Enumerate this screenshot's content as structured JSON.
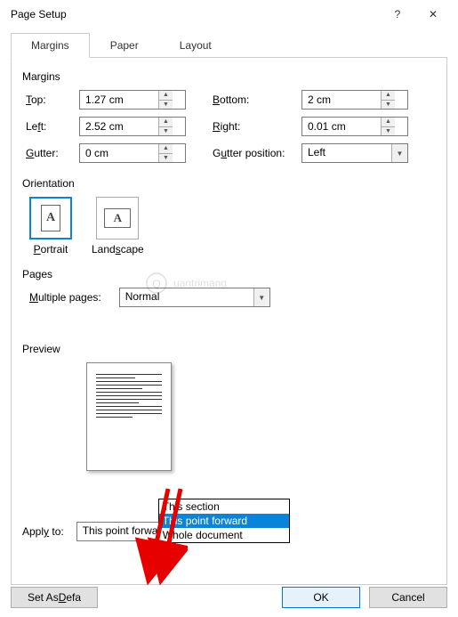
{
  "titlebar": {
    "title": "Page Setup",
    "help": "?",
    "close": "✕"
  },
  "tabs": {
    "margins": "Margins",
    "paper": "Paper",
    "layout": "Layout"
  },
  "margins": {
    "section": "Margins",
    "top_label": "op:",
    "top_value": "1.27 cm",
    "bottom_label": "ottom:",
    "bottom_value": "2 cm",
    "left_label": "Le",
    "left_label2": "t:",
    "left_value": "2.52 cm",
    "right_label": "ight:",
    "right_value": "0.01 cm",
    "gutter_label": "utter:",
    "gutter_value": "0 cm",
    "gutterpos_label": "G",
    "gutterpos_label2": "tter position:",
    "gutterpos_value": "Left"
  },
  "orientation": {
    "section": "Orientation",
    "portrait": "ortrait",
    "landscape": "Land",
    "landscape2": "cape"
  },
  "pages": {
    "section": "Pages",
    "multiple_label": "ultiple pages:",
    "multiple_value": "Normal"
  },
  "preview": {
    "section": "Preview"
  },
  "applyto": {
    "label": "Appl",
    "label2": " to:",
    "value": "This point forward",
    "opt1": "This section",
    "opt2": "This point forward",
    "opt3": "Whole document"
  },
  "footer": {
    "setdefault": "Set As Defa",
    "ok": "OK",
    "cancel": "Cancel"
  },
  "watermark": "uantrimang"
}
